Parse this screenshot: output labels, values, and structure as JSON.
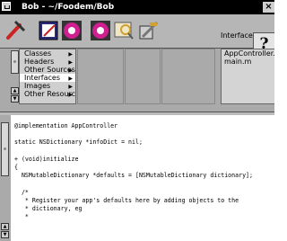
{
  "window": {
    "title": "Bob - ~/Foodem/Bob",
    "close_glyph": "×"
  },
  "toolbar": {
    "buttons": [
      {
        "name": "build-icon",
        "color": "#cc2222"
      },
      {
        "name": "edit-icon",
        "color": "#2a2a7a"
      },
      {
        "name": "run-icon",
        "color": "#d02090"
      },
      {
        "name": "debug-icon",
        "color": "#d02090"
      },
      {
        "name": "find-icon",
        "color": "#d0a030"
      },
      {
        "name": "clean-icon",
        "color": "#777777"
      }
    ],
    "current_section": "Interfaces",
    "help_glyph": "?"
  },
  "browser": {
    "categories": [
      {
        "label": "Classes",
        "selected": false
      },
      {
        "label": "Headers",
        "selected": false
      },
      {
        "label": "Other Sources",
        "selected": false
      },
      {
        "label": "Interfaces",
        "selected": true
      },
      {
        "label": "Images",
        "selected": false
      },
      {
        "label": "Other Resource",
        "selected": false
      }
    ],
    "files": [
      "AppController.m",
      "main.m"
    ]
  },
  "editor": {
    "code": "@implementation AppController\n\nstatic NSDictionary *infoDict = nil;\n\n+ (void)initialize\n{\n  NSMutableDictionary *defaults = [NSMutableDictionary dictionary];\n\n  /*\n   * Register your app's defaults here by adding objects to the\n   * dictionary, eg\n   *"
  }
}
